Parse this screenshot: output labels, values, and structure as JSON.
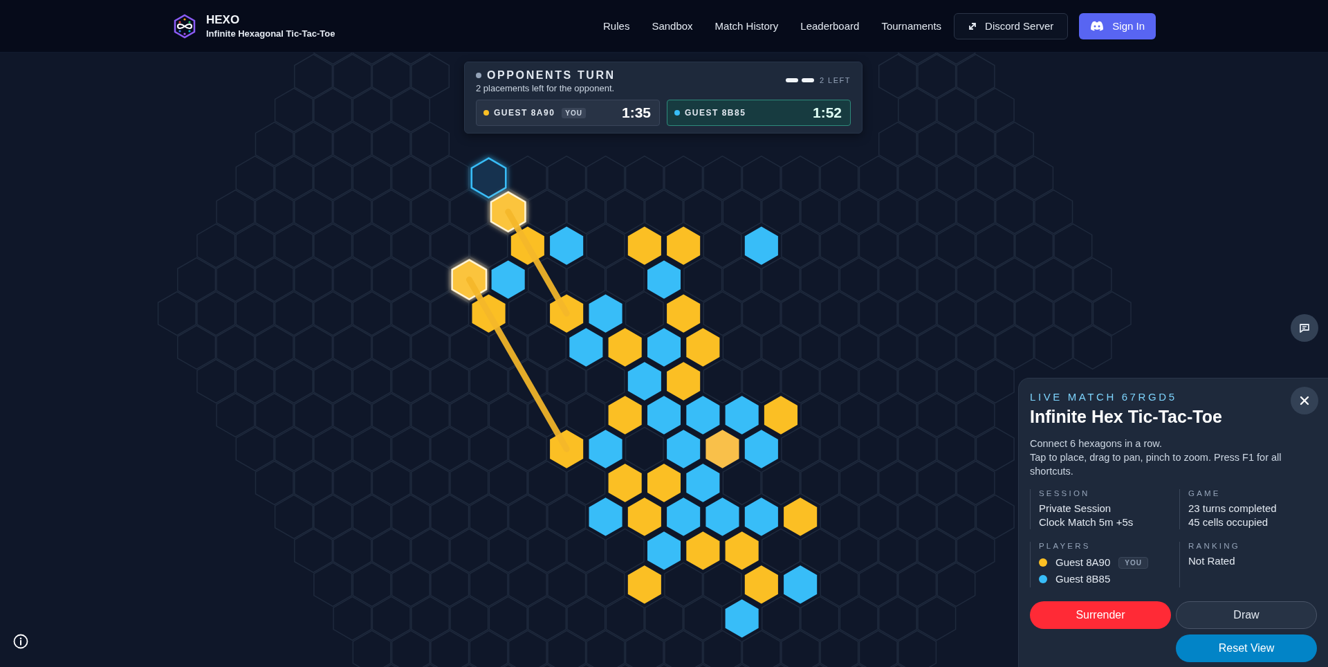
{
  "header": {
    "title": "HEXO",
    "subtitle": "Infinite Hexagonal Tic-Tac-Toe",
    "nav": [
      "Rules",
      "Sandbox",
      "Match History",
      "Leaderboard",
      "Tournaments"
    ],
    "discord_button": "Discord Server",
    "sign_in_button": "Sign In"
  },
  "turn": {
    "title": "OPPONENTS TURN",
    "message": "2 placements left for the opponent.",
    "placements_left": "2 LEFT",
    "pips": [
      {
        "filled": true
      },
      {
        "filled": true
      }
    ],
    "players": [
      {
        "name": "GUEST 8A90",
        "badge": "YOU",
        "clock": "1:35",
        "color": "#fbbf24",
        "active": false
      },
      {
        "name": "GUEST 8B85",
        "clock": "1:52",
        "color": "#38bdf8",
        "active": true
      }
    ]
  },
  "board": {
    "rows": [
      {
        "cells": [
          {
            "kind": "empty"
          },
          {
            "kind": "hover"
          }
        ]
      },
      {
        "cells": [
          {
            "kind": "empty"
          },
          {
            "kind": "gold-recent",
            "line_start": true
          }
        ]
      },
      {
        "cells": [
          {
            "kind": "empty"
          },
          {
            "kind": "empty"
          },
          {
            "kind": "gold"
          },
          {
            "kind": "blue"
          },
          {
            "kind": "empty"
          },
          {
            "kind": "gold"
          },
          {
            "kind": "gold"
          },
          {
            "kind": "empty"
          },
          {
            "kind": "blue"
          }
        ]
      },
      {
        "cells": [
          {
            "kind": "gold-recent",
            "line_start": true
          },
          {
            "kind": "blue"
          },
          {
            "kind": "empty"
          },
          {
            "kind": "empty"
          },
          {
            "kind": "empty"
          },
          {
            "kind": "blue"
          }
        ]
      },
      {
        "cells": [
          {
            "kind": "empty"
          },
          {
            "kind": "gold"
          },
          {
            "kind": "empty"
          },
          {
            "kind": "gold",
            "line_end": true
          },
          {
            "kind": "blue"
          },
          {
            "kind": "empty"
          },
          {
            "kind": "gold"
          }
        ]
      },
      {
        "cells": [
          {
            "kind": "empty"
          },
          {
            "kind": "empty"
          },
          {
            "kind": "empty"
          },
          {
            "kind": "blue"
          },
          {
            "kind": "gold"
          },
          {
            "kind": "blue"
          },
          {
            "kind": "gold"
          }
        ]
      },
      {
        "cells": [
          {
            "kind": "empty"
          },
          {
            "kind": "empty"
          },
          {
            "kind": "empty"
          },
          {
            "kind": "empty"
          },
          {
            "kind": "empty"
          },
          {
            "kind": "blue"
          },
          {
            "kind": "gold"
          }
        ]
      },
      {
        "cells": [
          {
            "kind": "empty"
          },
          {
            "kind": "empty"
          },
          {
            "kind": "empty"
          },
          {
            "kind": "empty"
          },
          {
            "kind": "gold"
          },
          {
            "kind": "blue"
          },
          {
            "kind": "blue"
          },
          {
            "kind": "blue"
          },
          {
            "kind": "gold"
          }
        ]
      },
      {
        "cells": [
          {
            "kind": "empty"
          },
          {
            "kind": "empty"
          },
          {
            "kind": "empty"
          },
          {
            "kind": "gold",
            "line_end": true
          },
          {
            "kind": "blue"
          },
          {
            "kind": "empty"
          },
          {
            "kind": "blue"
          },
          {
            "kind": "gold-faded"
          },
          {
            "kind": "blue"
          }
        ]
      },
      {
        "cells": [
          {
            "kind": "empty"
          },
          {
            "kind": "empty"
          },
          {
            "kind": "empty"
          },
          {
            "kind": "empty"
          },
          {
            "kind": "gold"
          },
          {
            "kind": "gold"
          },
          {
            "kind": "blue"
          }
        ]
      },
      {
        "cells": [
          {
            "kind": "empty"
          },
          {
            "kind": "empty"
          },
          {
            "kind": "empty"
          },
          {
            "kind": "empty"
          },
          {
            "kind": "blue"
          },
          {
            "kind": "gold"
          },
          {
            "kind": "blue"
          },
          {
            "kind": "blue"
          },
          {
            "kind": "blue"
          },
          {
            "kind": "gold"
          }
        ]
      },
      {
        "cells": [
          {
            "kind": "empty"
          },
          {
            "kind": "empty"
          },
          {
            "kind": "empty"
          },
          {
            "kind": "empty"
          },
          {
            "kind": "empty"
          },
          {
            "kind": "blue"
          },
          {
            "kind": "gold"
          },
          {
            "kind": "gold"
          }
        ]
      },
      {
        "cells": [
          {
            "kind": "empty"
          },
          {
            "kind": "empty"
          },
          {
            "kind": "empty"
          },
          {
            "kind": "empty"
          },
          {
            "kind": "empty"
          },
          {
            "kind": "gold"
          },
          {
            "kind": "empty"
          },
          {
            "kind": "empty"
          },
          {
            "kind": "gold"
          },
          {
            "kind": "blue"
          }
        ]
      },
      {
        "cells": [
          {
            "kind": "empty"
          },
          {
            "kind": "empty"
          },
          {
            "kind": "empty"
          },
          {
            "kind": "empty"
          },
          {
            "kind": "empty"
          },
          {
            "kind": "empty"
          },
          {
            "kind": "empty"
          },
          {
            "kind": "blue"
          }
        ]
      }
    ]
  },
  "match_panel": {
    "eyebrow": "LIVE MATCH 67RGD5",
    "title": "Infinite Hex Tic-Tac-Toe",
    "description_lines": [
      "Connect 6 hexagons in a row.",
      "Tap to place, drag to pan, pinch to zoom. Press F1 for all shortcuts."
    ],
    "sections": [
      {
        "heading": "SESSION",
        "kind": "lines",
        "lines": [
          "Private Session",
          "Clock Match 5m +5s"
        ]
      },
      {
        "heading": "GAME",
        "kind": "lines",
        "lines": [
          "23 turns completed",
          "45 cells occupied"
        ]
      },
      {
        "heading": "PLAYERS",
        "kind": "players",
        "players": [
          {
            "name": "Guest 8A90",
            "badge": "YOU",
            "color": "#fbbf24"
          },
          {
            "name": "Guest 8B85",
            "color": "#38bdf8"
          }
        ]
      },
      {
        "heading": "RANKING",
        "kind": "lines",
        "lines": [
          "Not Rated"
        ]
      }
    ],
    "buttons": [
      {
        "label": "Surrender",
        "kind": "danger"
      },
      {
        "label": "Draw",
        "kind": "secondary"
      },
      {
        "label": "Reset View",
        "kind": "primary"
      }
    ]
  }
}
